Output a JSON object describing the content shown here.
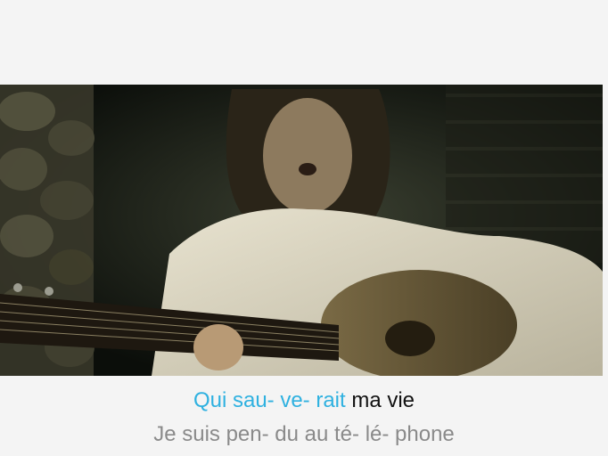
{
  "lyrics": {
    "current_line": {
      "sung": "Qui sau- ve- rait",
      "unsung": "ma vie"
    },
    "next_line": "Je suis pen- du au té- lé- phone"
  },
  "colors": {
    "sung_highlight": "#2fb1e0",
    "current_text": "#111111",
    "next_text": "#8a8a8a",
    "background": "#f4f4f4"
  }
}
